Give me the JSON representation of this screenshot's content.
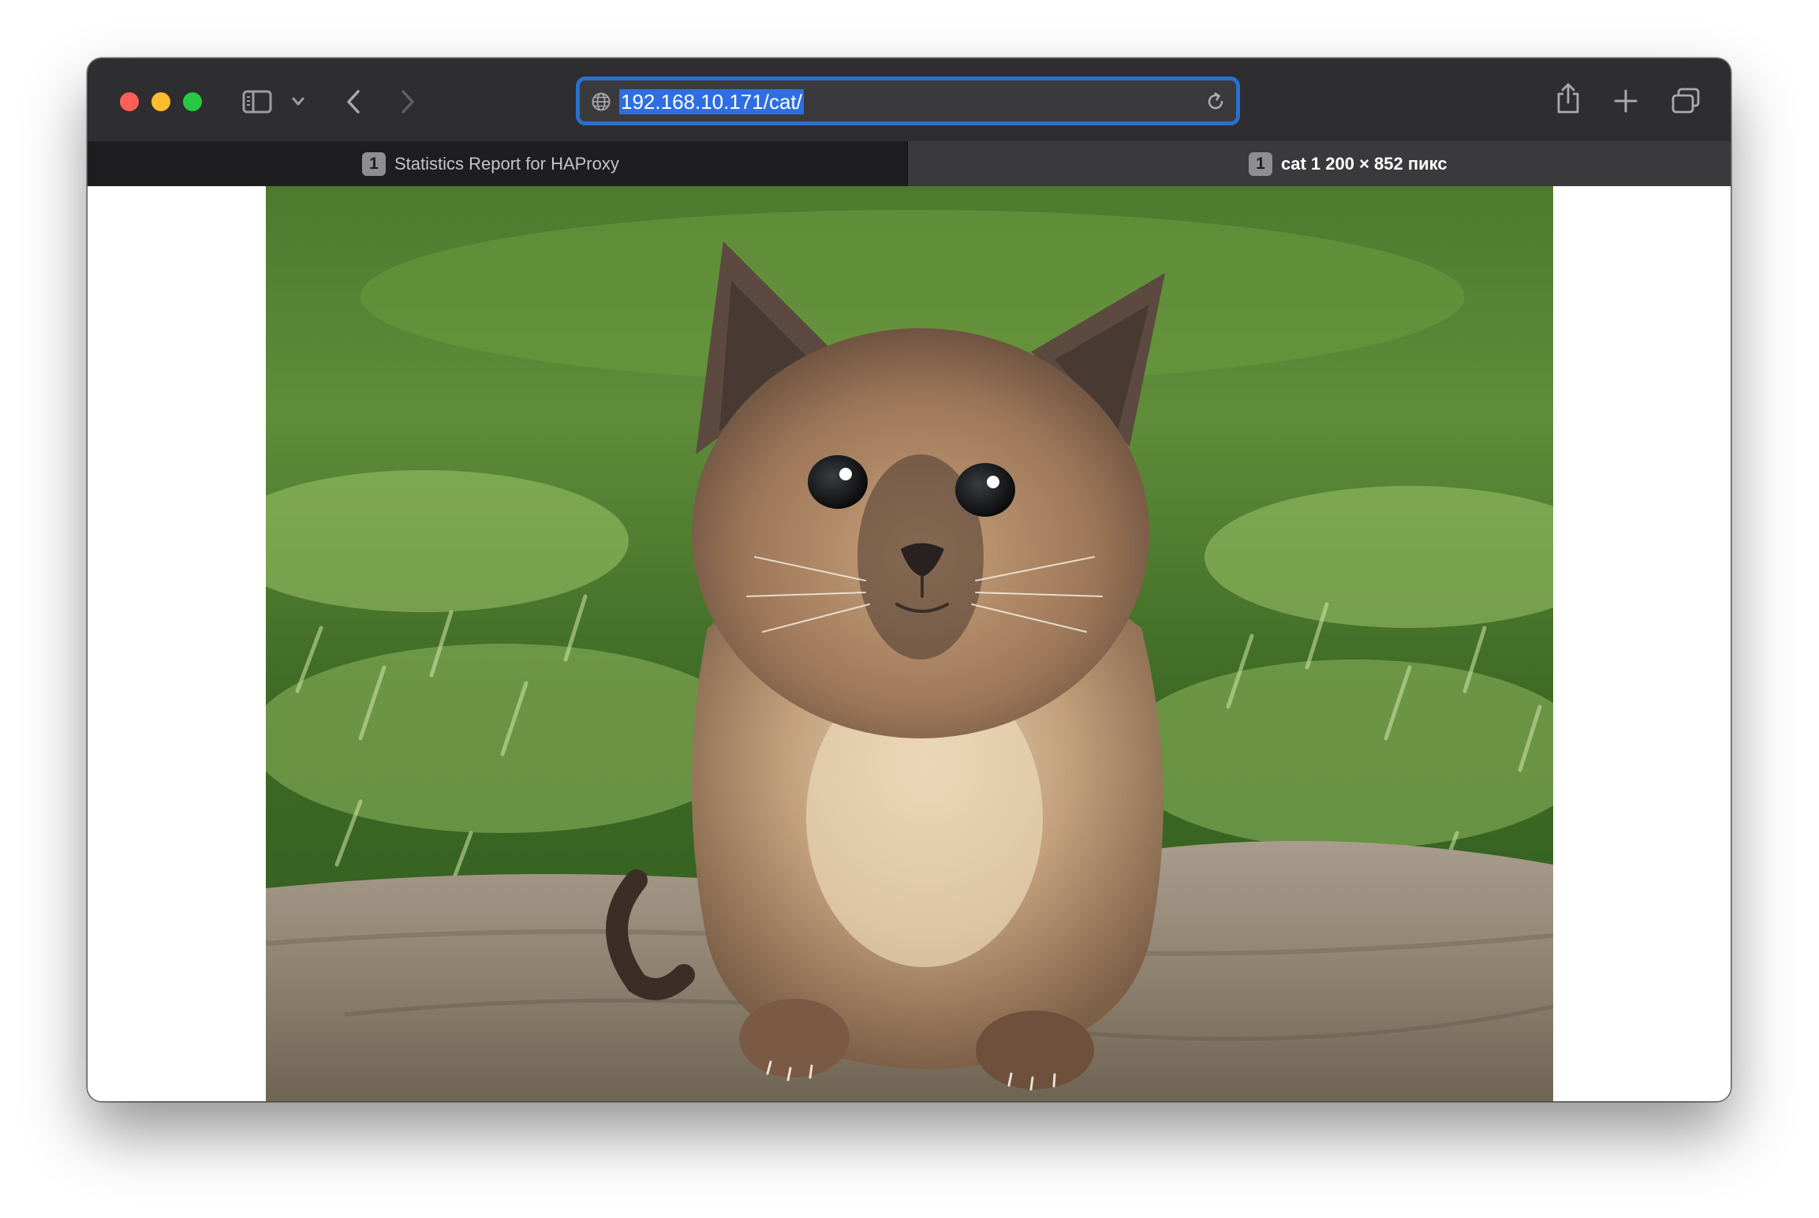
{
  "window": {
    "traffic_lights": {
      "close_color": "#fe5f57",
      "minimize_color": "#febc2e",
      "zoom_color": "#28c840"
    }
  },
  "toolbar": {
    "sidebar_icon": "sidebar-icon",
    "tab_group_chevron_icon": "chevron-down-icon",
    "back_icon": "chevron-left-icon",
    "forward_icon": "chevron-right-icon",
    "share_icon": "share-icon",
    "new_tab_icon": "plus-icon",
    "tab_overview_icon": "tab-overview-icon"
  },
  "address_bar": {
    "url": "192.168.10.171/cat/",
    "site_icon": "globe-icon",
    "reload_icon": "reload-icon",
    "accent": "#2a6fd1"
  },
  "tabs": [
    {
      "badge": "1",
      "title": "Statistics Report for HAProxy",
      "active": false
    },
    {
      "badge": "1",
      "title": "cat 1 200 × 852 пикс",
      "active": true
    }
  ],
  "content": {
    "image_subject": "kitten-photo"
  }
}
